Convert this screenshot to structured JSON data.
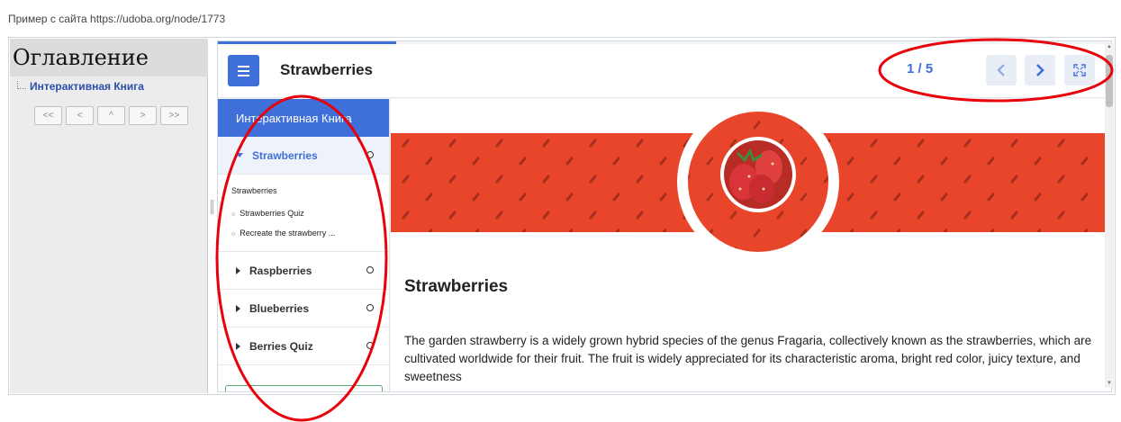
{
  "source_caption": "Пример с сайта https://udoba.org/node/1773",
  "toc": {
    "title": "Оглавление",
    "item": "Интерактивная Книга",
    "nav": [
      "<<",
      "<",
      "^",
      ">",
      ">>"
    ]
  },
  "book": {
    "title": "Strawberries",
    "page_counter": "1 / 5",
    "progress_fraction": 0.2,
    "accent_color": "#3f6fd8",
    "sidebar": {
      "header": "Интерактивная Книга",
      "chapters": [
        {
          "label": "Strawberries"
        },
        {
          "label": "Raspberries"
        },
        {
          "label": "Blueberries"
        },
        {
          "label": "Berries Quiz"
        }
      ],
      "sections": [
        "Strawberries",
        "Strawberries Quiz",
        "Recreate the strawberry ..."
      ]
    },
    "content": {
      "heading": "Strawberries",
      "paragraph": "The garden strawberry is a widely grown hybrid species of the genus Fragaria, collectively known as the strawberries, which are cultivated worldwide for their fruit. The fruit is widely appreciated for its characteristic aroma, bright red color, juicy texture, and sweetness",
      "banner_color": "#e8452a"
    }
  },
  "icons": {
    "menu": "hamburger-icon",
    "prev": "chevron-left-icon",
    "next": "chevron-right-icon",
    "fullscreen": "fullscreen-icon"
  },
  "annotation_color": "#e8000b"
}
